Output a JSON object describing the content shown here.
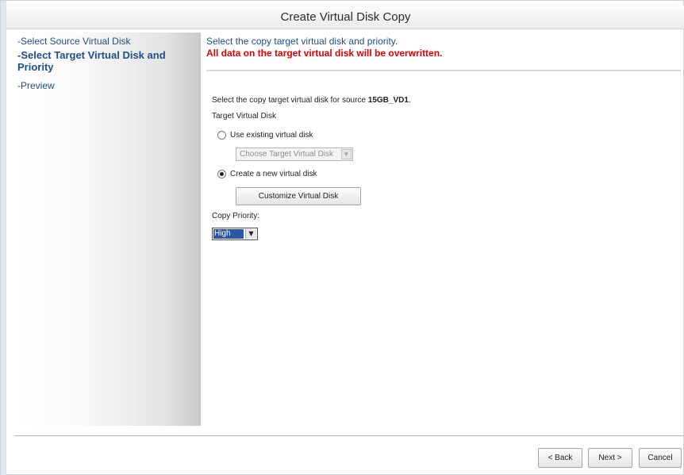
{
  "window": {
    "title": "Create Virtual Disk Copy"
  },
  "sidebar": {
    "steps": [
      {
        "label": "-Select Source Virtual Disk"
      },
      {
        "label": "-Select Target Virtual Disk and Priority"
      },
      {
        "label": "-Preview"
      }
    ]
  },
  "main": {
    "intro": "Select the copy target virtual disk and priority.",
    "warning": "All data on the target virtual disk will be overwritten.",
    "source_prefix": "Select the copy target virtual disk for source",
    "source_name": "15GB_VD1",
    "source_suffix": ".",
    "target_heading": "Target Virtual Disk",
    "option_existing": "Use existing virtual disk",
    "option_existing_selected": false,
    "target_dropdown_value": "Choose Target Virtual Disk",
    "option_new": "Create a new virtual disk",
    "option_new_selected": true,
    "customize_button": "Customize Virtual Disk",
    "priority_label": "Copy Priority:",
    "priority_value": "High"
  },
  "footer": {
    "back": "< Back",
    "next": "Next >",
    "cancel": "Cancel"
  },
  "icons": {
    "dropdown": "chevron-down-icon",
    "radio": "radio-icon"
  }
}
